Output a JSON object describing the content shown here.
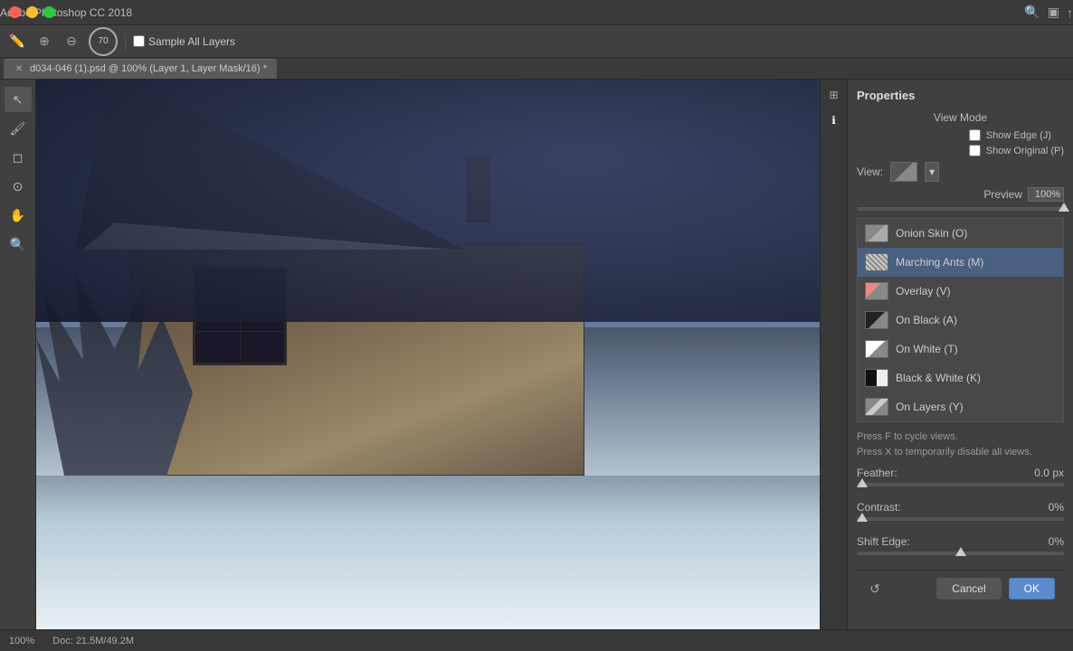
{
  "app": {
    "title": "Adobe Photoshop CC 2018",
    "tab_label": "d034-046 (1).psd @ 100% (Layer 1, Layer Mask/16) *"
  },
  "toolbar": {
    "brush_size": "70",
    "sample_all_layers_label": "Sample All Layers",
    "sample_all_layers_checked": false
  },
  "statusbar": {
    "zoom": "100%",
    "doc_size": "Doc: 21.5M/49.2M"
  },
  "properties_panel": {
    "title": "Properties",
    "view_mode_label": "View Mode",
    "view_label": "View:",
    "show_edge_label": "Show Edge (J)",
    "show_original_label": "Show Original (P)",
    "preview_label": "Preview",
    "preview_value": "100%",
    "view_modes": [
      {
        "id": "onion-skin",
        "label": "Onion Skin (O)",
        "icon_class": "icon-onion",
        "selected": false
      },
      {
        "id": "marching-ants",
        "label": "Marching Ants (M)",
        "icon_class": "icon-marching",
        "selected": false
      },
      {
        "id": "overlay",
        "label": "Overlay (V)",
        "icon_class": "icon-overlay",
        "selected": false
      },
      {
        "id": "on-black",
        "label": "On Black (A)",
        "icon_class": "icon-onblack",
        "selected": false
      },
      {
        "id": "on-white",
        "label": "On White (T)",
        "icon_class": "icon-onwhite",
        "selected": false
      },
      {
        "id": "black-white",
        "label": "Black & White (K)",
        "icon_class": "icon-bw",
        "selected": false
      },
      {
        "id": "on-layers",
        "label": "On Layers (Y)",
        "icon_class": "icon-onlayers",
        "selected": false
      }
    ],
    "hint_line1": "Press F to cycle views.",
    "hint_line2": "Press X to temporarily disable all views.",
    "feather_label": "Feather:",
    "feather_value": "0.0 px",
    "contrast_label": "Contrast:",
    "contrast_value": "0%",
    "shift_edge_label": "Shift Edge:",
    "shift_edge_value": "0%",
    "cancel_label": "Cancel",
    "ok_label": "OK"
  }
}
